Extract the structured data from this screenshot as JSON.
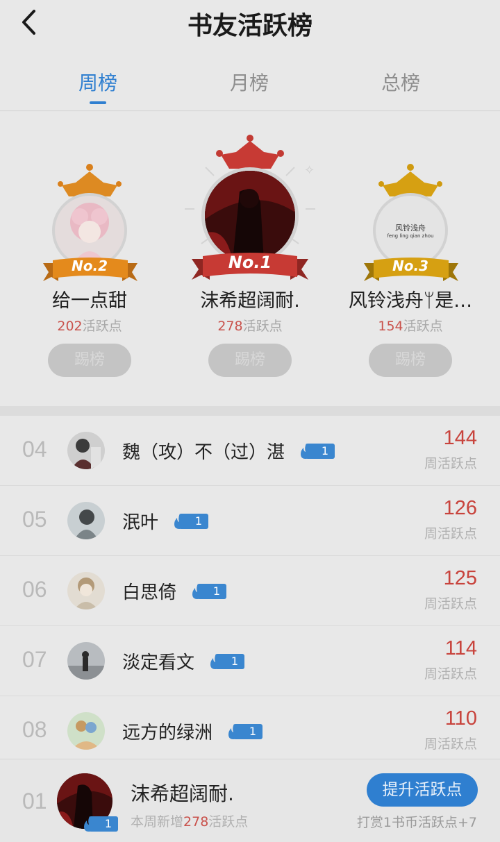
{
  "header": {
    "title": "书友活跃榜",
    "back_icon": "chevron-left-icon"
  },
  "tabs": [
    {
      "label": "周榜",
      "active": true
    },
    {
      "label": "月榜",
      "active": false
    },
    {
      "label": "总榜",
      "active": false
    }
  ],
  "podium": [
    {
      "rank_label": "No.2",
      "name": "给一点甜",
      "points": "202",
      "points_suffix": "活跃点",
      "button": "踢榜",
      "color": "#e48a1c"
    },
    {
      "rank_label": "No.1",
      "name": "沫希超阔耐.",
      "points": "278",
      "points_suffix": "活跃点",
      "button": "踢榜",
      "color": "#c73a34"
    },
    {
      "rank_label": "No.3",
      "name": "风铃浅舟ᛘ是…",
      "points": "154",
      "points_suffix": "活跃点",
      "button": "踢榜",
      "color": "#d6a012"
    }
  ],
  "podium_avatar_3_text": {
    "line1": "风铃浅舟",
    "line2": "feng ling qian zhou"
  },
  "list": [
    {
      "rank": "04",
      "name": "魏（攻）不（过）湛",
      "level": "1",
      "score": "144",
      "score_label": "周活跃点"
    },
    {
      "rank": "05",
      "name": "泯叶",
      "level": "1",
      "score": "126",
      "score_label": "周活跃点"
    },
    {
      "rank": "06",
      "name": "白思倚",
      "level": "1",
      "score": "125",
      "score_label": "周活跃点"
    },
    {
      "rank": "07",
      "name": "淡定看文",
      "level": "1",
      "score": "114",
      "score_label": "周活跃点"
    },
    {
      "rank": "08",
      "name": "远方的绿洲",
      "level": "1",
      "score": "110",
      "score_label": "周活跃点"
    }
  ],
  "me": {
    "rank": "01",
    "name": "沫希超阔耐.",
    "level": "1",
    "sub_prefix": "本周新增",
    "sub_points": "278",
    "sub_suffix": "活跃点",
    "button": "提升活跃点",
    "note": "打赏1书币活跃点+7"
  },
  "colors": {
    "accent": "#2f7fd0",
    "score": "#c8433c",
    "background": "#e8e8e8"
  }
}
